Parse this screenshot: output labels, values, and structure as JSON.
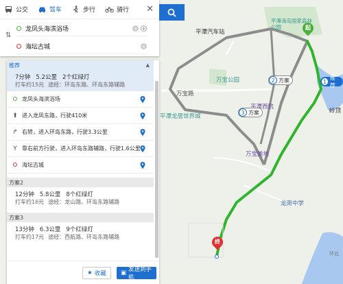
{
  "modes": [
    {
      "label": "公交",
      "icon": "bus-icon"
    },
    {
      "label": "驾车",
      "icon": "car-icon"
    },
    {
      "label": "步行",
      "icon": "walk-icon"
    },
    {
      "label": "骑行",
      "icon": "bike-icon"
    }
  ],
  "active_mode": "驾车",
  "origin": "龙凤头海滨浴场",
  "destination": "海坛古城",
  "plans": [
    {
      "tag": "推荐",
      "time": "7分钟",
      "distance": "5.2公里",
      "lights": "2个红绿灯",
      "fare": "打车约15元",
      "via": "途经：环岛东路、环岛东路辅路"
    },
    {
      "tag": "方案2",
      "time": "12分钟",
      "distance": "5.8公里",
      "lights": "8个红绿灯",
      "fare": "打车约16元",
      "via": "途经：龙山路、环岛东路辅路"
    },
    {
      "tag": "方案3",
      "time": "13分钟",
      "distance": "6.3公里",
      "lights": "9个红绿灯",
      "fare": "打车约17元",
      "via": "途经：西航路、环岛东路辅路"
    }
  ],
  "steps": [
    {
      "text": "龙凤头海滨浴场",
      "icon": "start-dot-icon"
    },
    {
      "text": "进入龙凤东路，行驶410米",
      "icon": "straight-arrow-icon"
    },
    {
      "text": "右转，进入环岛东路，行驶3.3公里",
      "icon": "turn-right-icon"
    },
    {
      "text": "靠右前方行驶，进入环岛东路辅路，行驶1.6公里",
      "icon": "keep-right-icon"
    },
    {
      "text": "海坛古城",
      "icon": "end-dot-icon"
    }
  ],
  "footer": {
    "favorite": "收藏",
    "send": "发送到手机"
  },
  "map": {
    "labels": {
      "pingtan_bus_station": "平潭汽车站",
      "forest_park": "平潭海岛国家森林公园",
      "wanbao_park": "万宝公园",
      "wanbao_road": "万宝路",
      "cinema": "平潭西航影城",
      "pingtan_longju": "平潭龙居世界城",
      "wanbao_meidi": "万宝美地",
      "longnan_school": "龙南中学",
      "linwan": "岭顶",
      "huanbei": "环北"
    },
    "route_tags": {
      "recommend": "推荐",
      "plan2": "方案",
      "plan3": "方案"
    },
    "start_label": "起",
    "end_label": "终",
    "colors": {
      "route_main": "#2fb52b",
      "route_alt": "#8c8c8c",
      "accent": "#1e6fd0",
      "start": "#4caf3e",
      "end": "#e03030"
    }
  }
}
